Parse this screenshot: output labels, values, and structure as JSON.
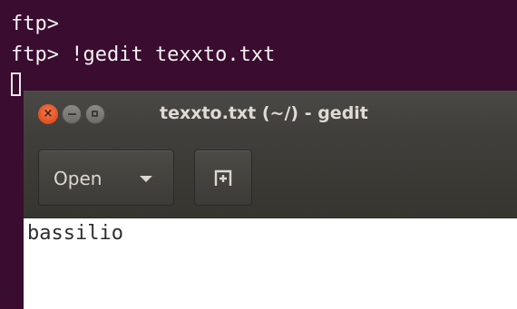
{
  "terminal": {
    "lines": [
      "ftp>",
      "ftp> !gedit texxto.txt"
    ]
  },
  "gedit": {
    "title": "texxto.txt (~/) - gedit",
    "toolbar": {
      "open_label": "Open",
      "open_dropdown_icon": "chevron-down-icon",
      "new_document_icon": "new-tab-icon"
    },
    "editor": {
      "content": "bassilio"
    },
    "colors": {
      "close_button": "#e95420",
      "titlebar": "#3f3e3a",
      "terminal_background": "#300a24"
    }
  }
}
